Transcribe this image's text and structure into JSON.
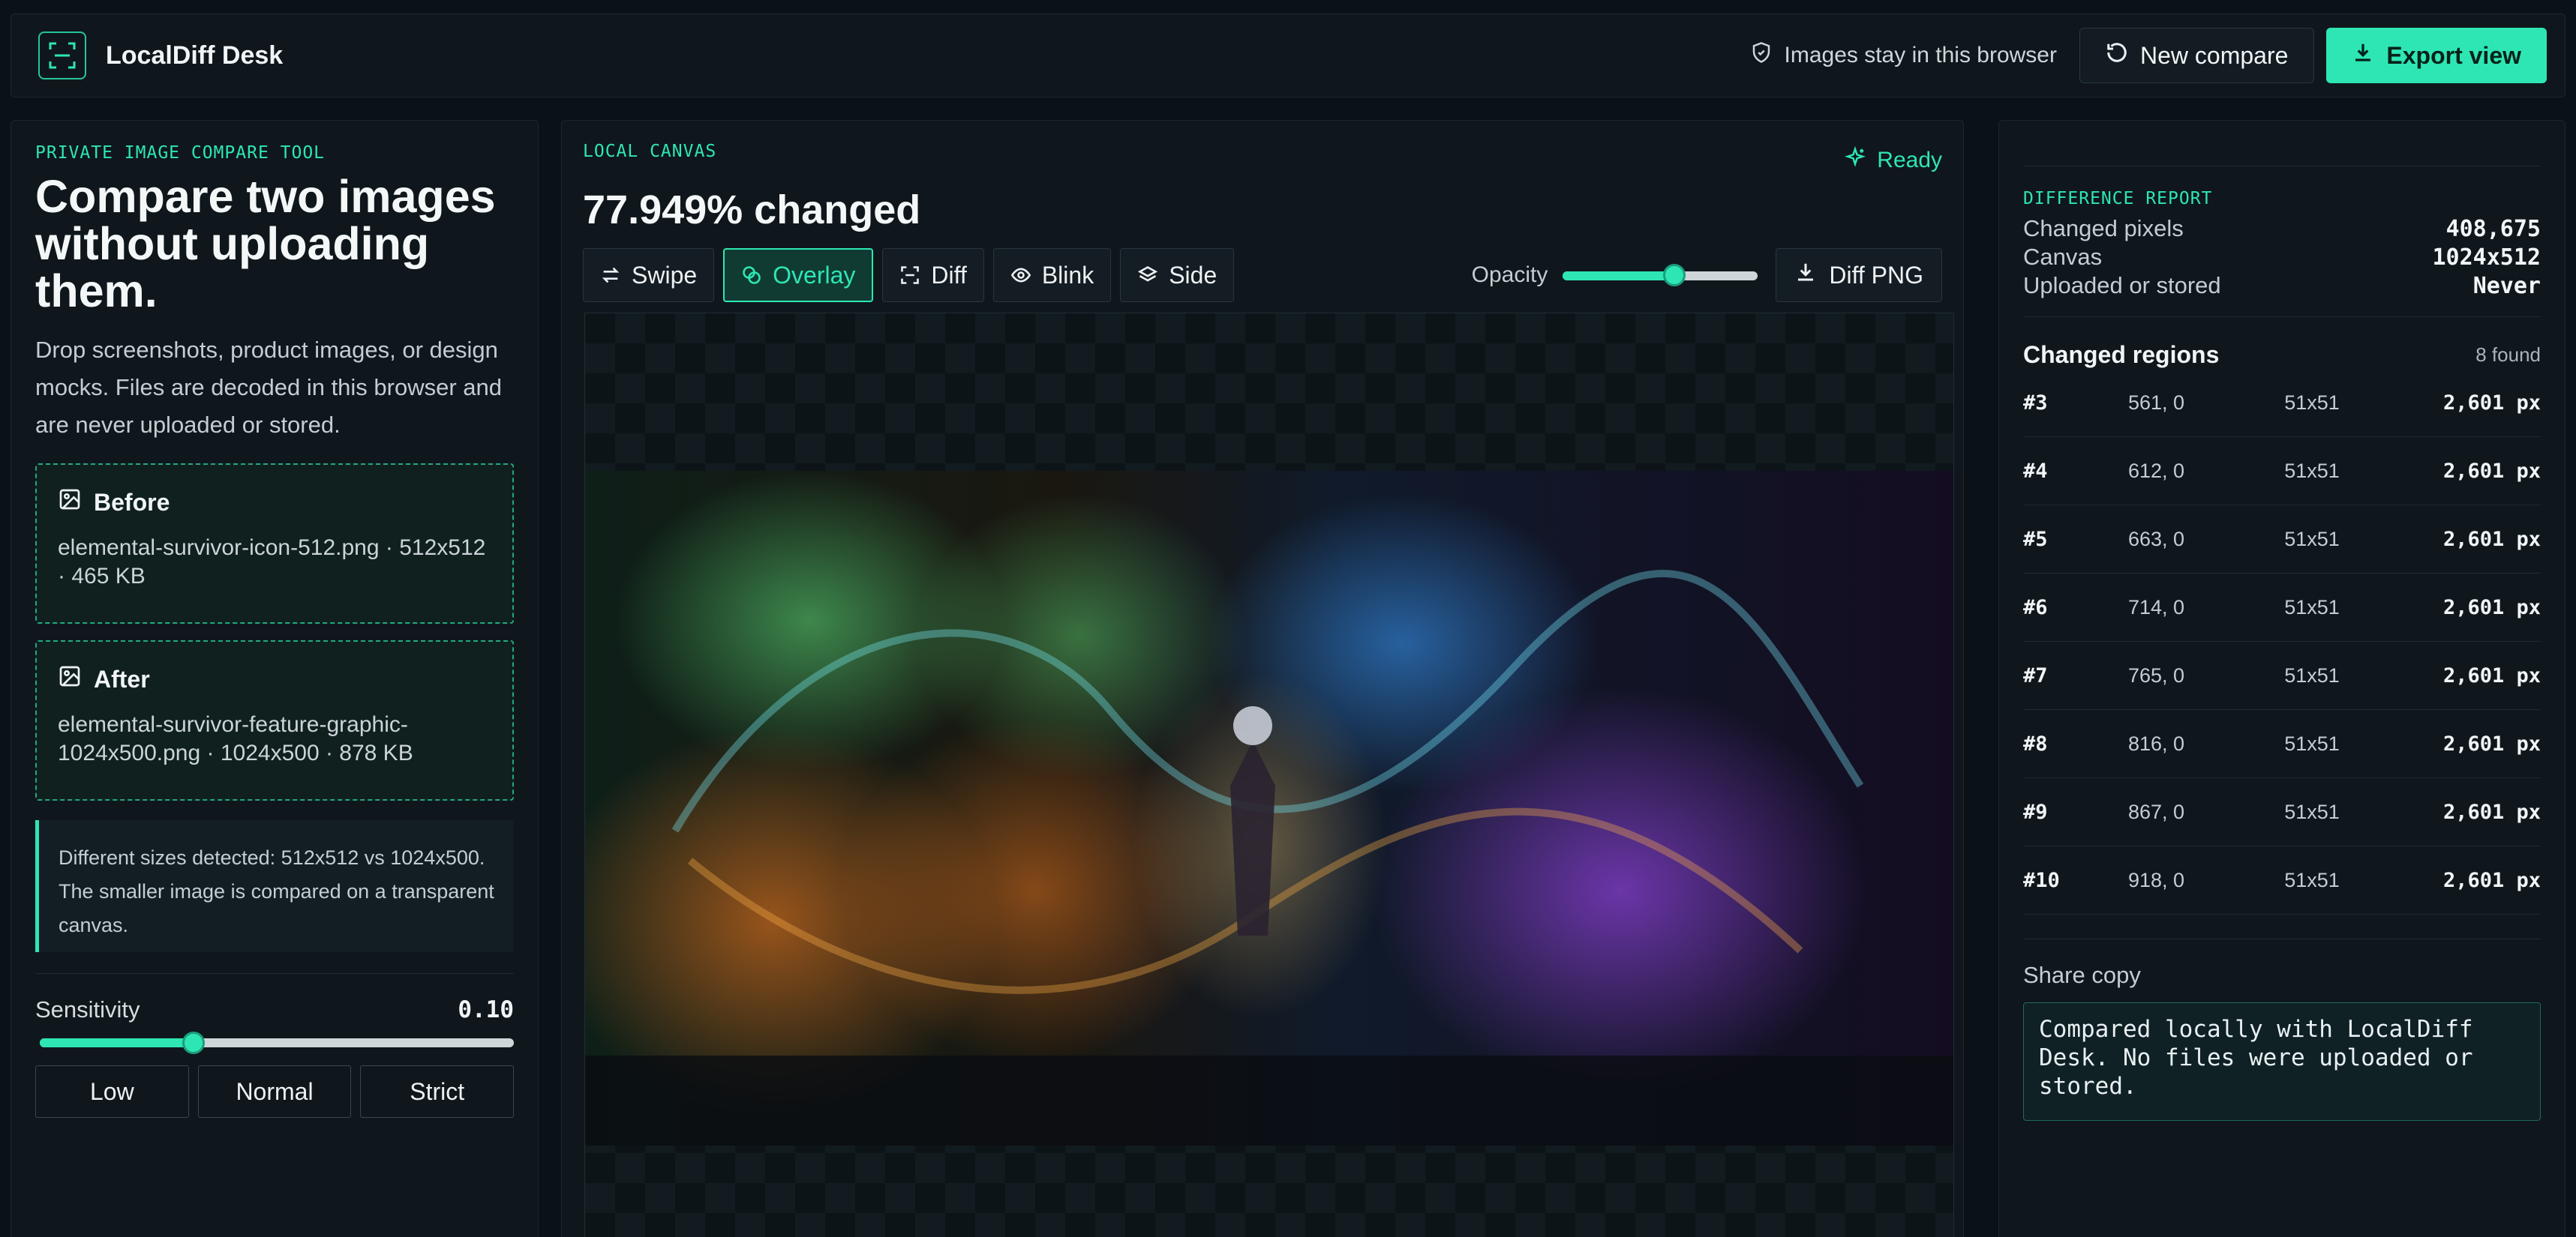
{
  "app": {
    "title": "LocalDiff Desk"
  },
  "header": {
    "privacy_note": "Images stay in this browser",
    "new_compare_label": "New compare",
    "export_label": "Export view"
  },
  "left": {
    "eyebrow": "PRIVATE IMAGE COMPARE TOOL",
    "title": "Compare two images without uploading them.",
    "lead": "Drop screenshots, product images, or design mocks. Files are decoded in this browser and are never uploaded or stored.",
    "before": {
      "label": "Before",
      "file": "elemental-survivor-icon-512.png · 512x512 · 465 KB"
    },
    "after": {
      "label": "After",
      "file": "elemental-survivor-feature-graphic-1024x500.png · 1024x500 · 878 KB"
    },
    "notice": "Different sizes detected: 512x512 vs 1024x500. The smaller image is compared on a transparent canvas.",
    "sensitivity": {
      "label": "Sensitivity",
      "value_text": "0.10",
      "fraction": 0.33
    },
    "presets": [
      "Low",
      "Normal",
      "Strict"
    ]
  },
  "center": {
    "eyebrow": "LOCAL CANVAS",
    "changed": "77.949% changed",
    "status": "Ready",
    "modes": [
      {
        "label": "Swipe",
        "icon": "swap-arrows-icon",
        "active": false
      },
      {
        "label": "Overlay",
        "icon": "overlay-icon",
        "active": true
      },
      {
        "label": "Diff",
        "icon": "scan-icon",
        "active": false
      },
      {
        "label": "Blink",
        "icon": "eye-icon",
        "active": false
      },
      {
        "label": "Side",
        "icon": "layers-icon",
        "active": false
      }
    ],
    "opacity": {
      "label": "Opacity",
      "fraction": 0.57
    },
    "diff_png_label": "Diff PNG"
  },
  "right": {
    "eyebrow": "DIFFERENCE REPORT",
    "stats": [
      {
        "label": "Changed pixels",
        "value": "408,675"
      },
      {
        "label": "Canvas",
        "value": "1024x512"
      },
      {
        "label": "Uploaded or stored",
        "value": "Never"
      }
    ],
    "regions_title": "Changed regions",
    "regions_count": "8 found",
    "regions": [
      {
        "id": "#3",
        "xy": "561, 0",
        "size": "51x51",
        "px": "2,601 px"
      },
      {
        "id": "#4",
        "xy": "612, 0",
        "size": "51x51",
        "px": "2,601 px"
      },
      {
        "id": "#5",
        "xy": "663, 0",
        "size": "51x51",
        "px": "2,601 px"
      },
      {
        "id": "#6",
        "xy": "714, 0",
        "size": "51x51",
        "px": "2,601 px"
      },
      {
        "id": "#7",
        "xy": "765, 0",
        "size": "51x51",
        "px": "2,601 px"
      },
      {
        "id": "#8",
        "xy": "816, 0",
        "size": "51x51",
        "px": "2,601 px"
      },
      {
        "id": "#9",
        "xy": "867, 0",
        "size": "51x51",
        "px": "2,601 px"
      },
      {
        "id": "#10",
        "xy": "918, 0",
        "size": "51x51",
        "px": "2,601 px"
      }
    ],
    "share_label": "Share copy",
    "share_text": "Compared locally with LocalDiff Desk. No files were uploaded or stored."
  },
  "colors": {
    "accent": "#2ee6b4",
    "background": "#0b1217",
    "panel": "#0f171c"
  }
}
